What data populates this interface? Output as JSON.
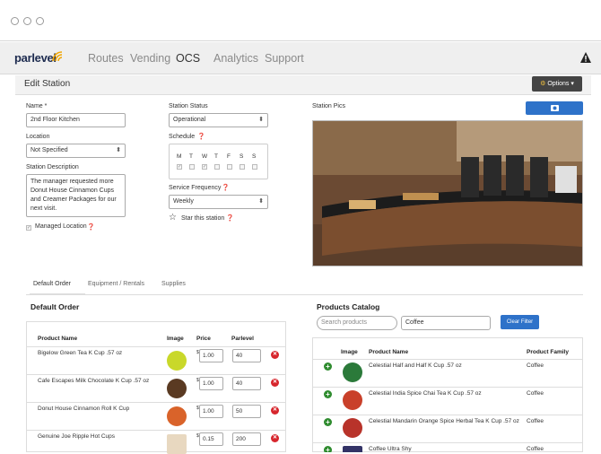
{
  "nav": {
    "logo": "parlevel",
    "items": [
      "Routes",
      "Vending",
      "OCS",
      "Analytics",
      "Support"
    ],
    "active": "OCS"
  },
  "page": {
    "title": "Edit Station",
    "options_label": "Options"
  },
  "form": {
    "name_label": "Name *",
    "name_value": "2nd Floor Kitchen",
    "location_label": "Location",
    "location_value": "Not Specified",
    "description_label": "Station Description",
    "description_value": "The manager requested more Donut House Cinnamon Cups and Creamer Packages for our next visit.",
    "managed_location_label": "Managed Location",
    "status_label": "Station Status",
    "status_value": "Operational",
    "schedule_label": "Schedule",
    "days": [
      "M",
      "T",
      "W",
      "T",
      "F",
      "S",
      "S"
    ],
    "frequency_label": "Service Frequency",
    "frequency_value": "Weekly",
    "star_label": "Star this station",
    "pics_label": "Station Pics"
  },
  "tabs": [
    "Default Order",
    "Equipment / Rentals",
    "Supplies"
  ],
  "default_order": {
    "title": "Default Order",
    "columns": [
      "Product Name",
      "Image",
      "Price",
      "Parlevel"
    ],
    "rows": [
      {
        "name": "Bigelow Green Tea K Cup .57 oz",
        "price": "1.00",
        "parlevel": "40",
        "color": "#c9d82a"
      },
      {
        "name": "Cafe Escapes Milk Chocolate K Cup .57 oz",
        "price": "1.00",
        "parlevel": "40",
        "color": "#5a3a22"
      },
      {
        "name": "Donut House Cinnamon Roll K Cup",
        "price": "1.00",
        "parlevel": "50",
        "color": "#d9632a"
      },
      {
        "name": "Genuine Joe Ripple Hot Cups",
        "price": "0.15",
        "parlevel": "200",
        "color": "#e8d8c0"
      }
    ],
    "currency": "$"
  },
  "catalog": {
    "title": "Products Catalog",
    "search_placeholder": "Search products",
    "filter_value": "Coffee",
    "clear_label": "Clear Filter",
    "columns": [
      "Image",
      "Product Name",
      "Product Family"
    ],
    "rows": [
      {
        "name": "Celestial Half and Half K Cup .57 oz",
        "family": "Coffee",
        "color": "#2b7a3a"
      },
      {
        "name": "Celestial India Spice Chai Tea K Cup .57 oz",
        "family": "Coffee",
        "color": "#c9402a"
      },
      {
        "name": "Celestial Mandarin Orange Spice Herbal Tea K Cup .57 oz",
        "family": "Coffee",
        "color": "#b8332a"
      },
      {
        "name": "Coffee Ultra Shy",
        "family": "Coffee",
        "color": "#333366"
      }
    ]
  }
}
